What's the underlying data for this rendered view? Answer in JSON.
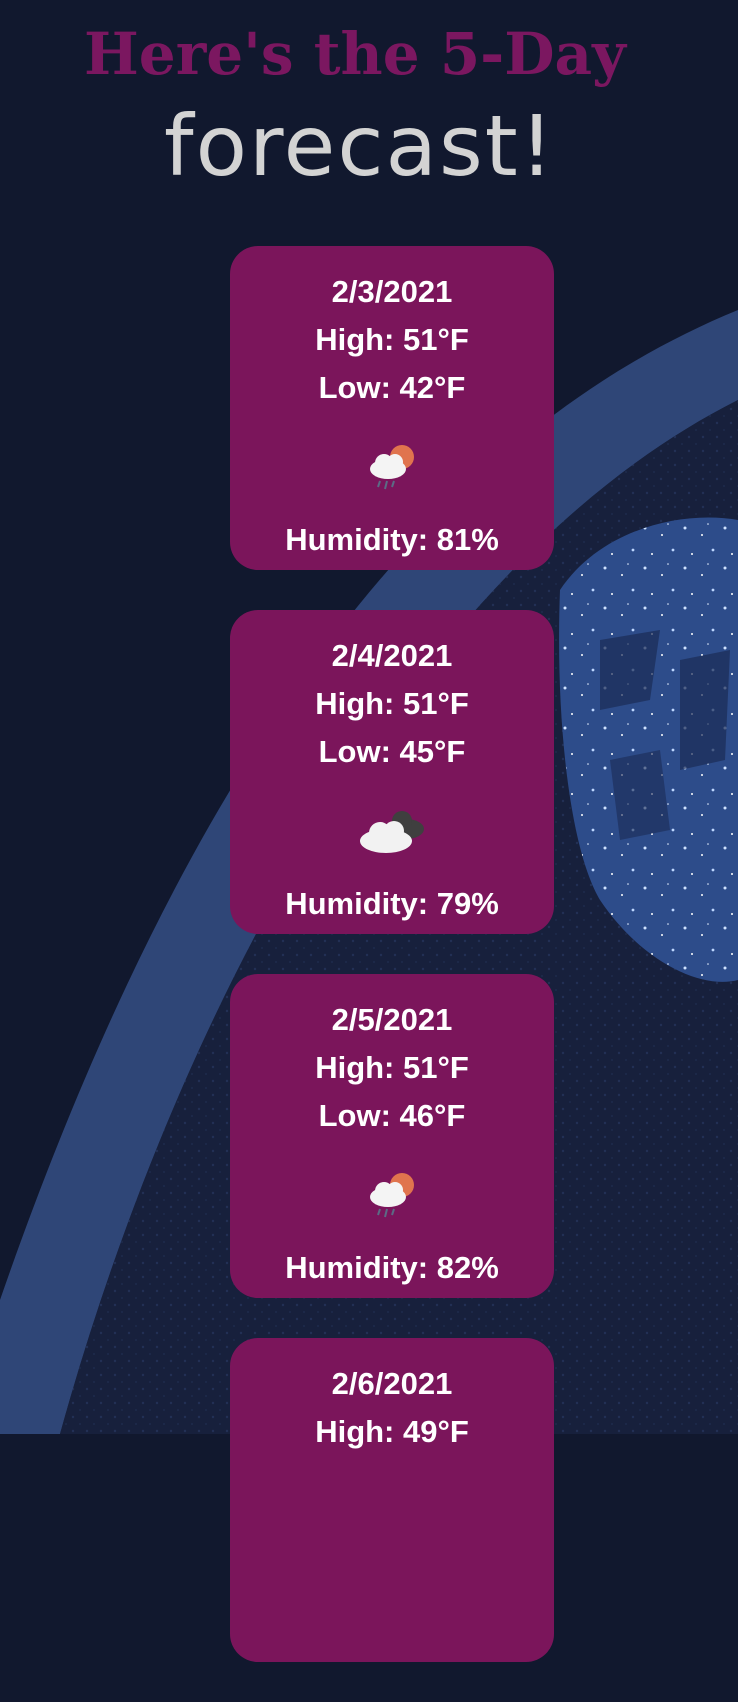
{
  "heading": {
    "line1": "Here's the 5-Day",
    "line2": "forecast!"
  },
  "labels": {
    "high_prefix": "High: ",
    "low_prefix": "Low: ",
    "humidity_prefix": "Humidity: "
  },
  "colors": {
    "page_background": "#11182e",
    "heading_accent": "#7b1760",
    "heading_secondary": "#d3d3d3",
    "card_background": "#7b155b",
    "card_text": "#ffffff"
  },
  "forecast": [
    {
      "date": "2/3/2021",
      "high": "High: 51°F",
      "low": "Low: 42°F",
      "icon": "rain-sun-cloud-icon",
      "humidity": "Humidity: 81%"
    },
    {
      "date": "2/4/2021",
      "high": "High: 51°F",
      "low": "Low: 45°F",
      "icon": "overcast-clouds-icon",
      "humidity": "Humidity: 79%"
    },
    {
      "date": "2/5/2021",
      "high": "High: 51°F",
      "low": "Low: 46°F",
      "icon": "rain-sun-cloud-icon",
      "humidity": "Humidity: 82%"
    },
    {
      "date": "2/6/2021",
      "high": "High: 49°F",
      "low": "",
      "icon": "",
      "humidity": ""
    }
  ]
}
